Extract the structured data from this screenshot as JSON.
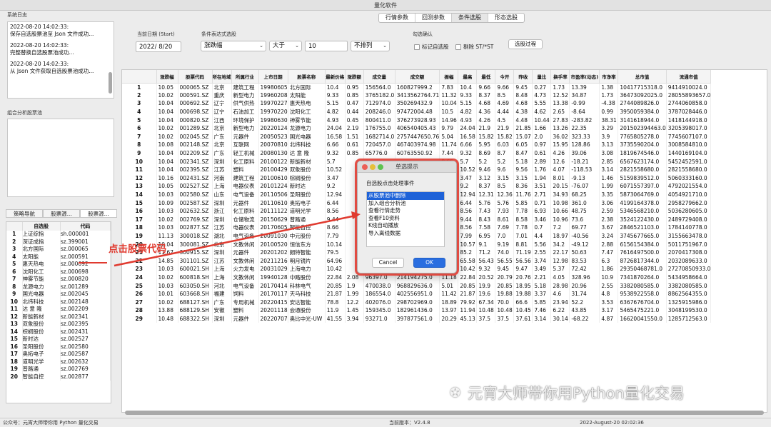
{
  "window": {
    "title": "量化软件"
  },
  "top_tabs": [
    "行情参数",
    "回测参数",
    "条件选股",
    "形态选股"
  ],
  "left": {
    "log_label": "系统日志",
    "log_lines": [
      "2022-08-20 14:02:33:",
      "保存自选股票池至 Json 文件成功...",
      "2022-08-20 14:02:33:",
      "完整替换自选股票池成功...",
      "2022-08-20 14:02:33:",
      "从 Json 文件获取自选股票池成功..."
    ],
    "combo_label": "组合分析股票池",
    "tabs": [
      "策略导航",
      "股票源...",
      "股票源..."
    ],
    "table_headers": [
      "",
      "自选股",
      "代码"
    ],
    "rows": [
      [
        "1",
        "上证综指",
        "sh.000001"
      ],
      [
        "2",
        "深证成指",
        "sz.399001"
      ],
      [
        "3",
        "北方国际",
        "sz.000065"
      ],
      [
        "4",
        "太阳能",
        "sz.000591"
      ],
      [
        "5",
        "惠天热电",
        "sz.000692"
      ],
      [
        "6",
        "沈阳化工",
        "sz.000698"
      ],
      [
        "7",
        "神雾节能",
        "sz.000820"
      ],
      [
        "8",
        "龙源电力",
        "sz.001289"
      ],
      [
        "9",
        "国光电器",
        "sz.002045"
      ],
      [
        "10",
        "北纬科技",
        "sz.002148"
      ],
      [
        "11",
        "达 意 隆",
        "sz.002209"
      ],
      [
        "12",
        "新能新材",
        "sz.002341"
      ],
      [
        "13",
        "双象股份",
        "sz.002395"
      ],
      [
        "14",
        "棕榈股份",
        "sz.002431"
      ],
      [
        "15",
        "新时达",
        "sz.002527"
      ],
      [
        "16",
        "圣阳股份",
        "sz.002580"
      ],
      [
        "17",
        "奥拓电子",
        "sz.002587"
      ],
      [
        "18",
        "道明光学",
        "sz.002632"
      ],
      [
        "19",
        "普路通",
        "sz.002769"
      ],
      [
        "20",
        "智能自控",
        "sz.002877"
      ]
    ]
  },
  "controls": {
    "date_label": "当前日期 (Start)",
    "date_value": "2022/  8/20",
    "cond_label": "条件表达式选股",
    "field_value": "涨跌幅",
    "op_value": "大于",
    "num_value": "10",
    "sort_value": "不排列",
    "confirm_label": "勾选确认",
    "chk1": "标记自选股",
    "chk2": "剔除 ST/*ST",
    "run_button": "选股过程"
  },
  "main_table": {
    "headers": [
      "",
      "涨跌幅",
      "股票代码",
      "所在地域",
      "所属行业",
      "上市日期",
      "股票名称",
      "最新价格",
      "涨跌额",
      "成交量",
      "成交额",
      "振幅",
      "最高",
      "最低",
      "今开",
      "昨收",
      "量比",
      "换手率",
      "市盈率(动态)",
      "市净率",
      "总市值",
      "流通市值"
    ],
    "rows": [
      [
        "1",
        "10.05",
        "000065.SZ",
        "北京",
        "建筑工程",
        "19980605",
        "北方国际",
        "10.4",
        "0.95",
        "156564.0",
        "160827999.2",
        "7.83",
        "10.4",
        "9.66",
        "9.66",
        "9.45",
        "0.27",
        "1.73",
        "13.39",
        "1.38",
        "10417715318.0",
        "9414910024.0"
      ],
      [
        "2",
        "10.02",
        "000591.SZ",
        "重庆",
        "新型电力",
        "19960208",
        "太阳能",
        "9.33",
        "0.85",
        "3765182.0",
        "3413562764.71",
        "11.32",
        "9.33",
        "8.37",
        "8.5",
        "8.48",
        "4.73",
        "12.52",
        "34.87",
        "1.73",
        "36473092025.0",
        "28055893657.0"
      ],
      [
        "3",
        "10.04",
        "000692.SZ",
        "辽宁",
        "供气供热",
        "19970227",
        "惠天热电",
        "5.15",
        "0.47",
        "712974.0",
        "350269432.9",
        "10.04",
        "5.15",
        "4.68",
        "4.69",
        "4.68",
        "5.55",
        "13.38",
        "-0.99",
        "-4.38",
        "2744089826.0",
        "2744060858.0"
      ],
      [
        "4",
        "10.04",
        "000698.SZ",
        "辽宁",
        "石油加工",
        "19970220",
        "沈阳化工",
        "4.82",
        "0.44",
        "208246.0",
        "97472004.48",
        "10.5",
        "4.82",
        "4.36",
        "4.44",
        "4.38",
        "4.62",
        "2.65",
        "-8.64",
        "0.99",
        "3950059384.0",
        "3787028446.0"
      ],
      [
        "5",
        "10.04",
        "000820.SZ",
        "江西",
        "环境保护",
        "19980630",
        "神雾节能",
        "4.93",
        "0.45",
        "800411.0",
        "376273928.93",
        "14.96",
        "4.93",
        "4.26",
        "4.5",
        "4.48",
        "10.44",
        "27.83",
        "-283.82",
        "38.31",
        "3141618944.0",
        "1418144918.0"
      ],
      [
        "6",
        "10.02",
        "001289.SZ",
        "北京",
        "新型电力",
        "20220124",
        "龙源电力",
        "24.04",
        "2.19",
        "176755.0",
        "406540405.43",
        "9.79",
        "24.04",
        "21.9",
        "21.9",
        "21.85",
        "1.66",
        "13.26",
        "22.35",
        "3.29",
        "201502394463.0",
        "3205398017.0"
      ],
      [
        "7",
        "10.02",
        "002045.SZ",
        "广东",
        "元器件",
        "20050523",
        "国光电器",
        "16.58",
        "1.51",
        "1682714.0",
        "2757447650.76",
        "5.04",
        "16.58",
        "15.82",
        "15.82",
        "15.07",
        "2.0",
        "36.02",
        "323.33",
        "3.9",
        "7765805278.0",
        "7745607107.0"
      ],
      [
        "8",
        "10.08",
        "002148.SZ",
        "北京",
        "互联网",
        "20070810",
        "北纬科技",
        "6.66",
        "0.61",
        "720457.0",
        "467403974.98",
        "11.74",
        "6.66",
        "5.95",
        "6.03",
        "6.05",
        "0.97",
        "15.95",
        "128.86",
        "3.13",
        "3735590204.0",
        "3008584810.0"
      ],
      [
        "9",
        "10.04",
        "002209.SZ",
        "广东",
        "轻工机械",
        "20080130",
        "达 意 隆",
        "9.32",
        "0.85",
        "65776.0",
        "60763550.92",
        "7.44",
        "9.32",
        "8.69",
        "8.7",
        "8.47",
        "0.61",
        "4.26",
        "39.06",
        "3.08",
        "1819674546.0",
        "1440169104.0"
      ],
      [
        "10",
        "10.04",
        "002341.SZ",
        "深圳",
        "化工原料",
        "20100122",
        "新能新材",
        "5.7",
        "",
        "",
        "",
        "9.65",
        "5.7",
        "5.2",
        "5.2",
        "5.18",
        "2.89",
        "12.6",
        "-18.21",
        "2.85",
        "6567623174.0",
        "5452452591.0"
      ],
      [
        "11",
        "10.04",
        "002395.SZ",
        "江苏",
        "塑料",
        "20100429",
        "双象股份",
        "10.52",
        "",
        "",
        "",
        "11.09",
        "10.52",
        "9.46",
        "9.6",
        "9.56",
        "1.76",
        "4.07",
        "-118.53",
        "3.14",
        "2821558680.0",
        "2821558680.0"
      ],
      [
        "12",
        "10.16",
        "002431.SZ",
        "河南",
        "建筑工程",
        "20100610",
        "棕榈股份",
        "3.47",
        "",
        "",
        "",
        "11.11",
        "3.47",
        "3.12",
        "3.15",
        "3.15",
        "1.94",
        "8.01",
        "-9.13",
        "1.46",
        "5159839512.0",
        "5060333160.0"
      ],
      [
        "13",
        "10.05",
        "002527.SZ",
        "上海",
        "电器仪表",
        "20101224",
        "新时达",
        "9.2",
        "",
        "",
        "",
        "9.93",
        "9.2",
        "8.37",
        "8.5",
        "8.36",
        "3.51",
        "20.15",
        "-76.07",
        "1.99",
        "6071557397.0",
        "4792021554.0"
      ],
      [
        "14",
        "10.03",
        "002580.SZ",
        "山东",
        "电气设备",
        "20110506",
        "圣阳股份",
        "12.94",
        "",
        "",
        "",
        "5.36",
        "12.94",
        "12.31",
        "12.36",
        "11.76",
        "2.71",
        "34.93",
        "68.25",
        "3.35",
        "5873064769.0",
        "4054921710.0"
      ],
      [
        "15",
        "10.09",
        "002587.SZ",
        "深圳",
        "元器件",
        "20110610",
        "奥拓电子",
        "6.44",
        "",
        "",
        "",
        "11.62",
        "6.44",
        "5.76",
        "5.76",
        "5.85",
        "0.71",
        "10.98",
        "361.0",
        "3.06",
        "4199164378.0",
        "2958279662.0"
      ],
      [
        "16",
        "10.03",
        "002632.SZ",
        "浙江",
        "化工原料",
        "20111122",
        "道明光学",
        "8.56",
        "",
        "",
        "",
        "14.52",
        "8.56",
        "7.43",
        "7.93",
        "7.78",
        "6.93",
        "10.66",
        "48.75",
        "2.59",
        "5346568210.0",
        "5036280605.0"
      ],
      [
        "17",
        "10.02",
        "002769.SZ",
        "深圳",
        "仓储物流",
        "20150629",
        "普路通",
        "9.44",
        "",
        "",
        "",
        "11.77",
        "9.44",
        "8.43",
        "8.61",
        "8.58",
        "3.46",
        "10.96",
        "73.6",
        "2.38",
        "3524122430.0",
        "2489729408.0"
      ],
      [
        "18",
        "10.03",
        "002877.SZ",
        "江苏",
        "电器仪表",
        "20170605",
        "智能自控",
        "8.66",
        "",
        "",
        "",
        "12.6",
        "8.56",
        "7.58",
        "7.69",
        "7.78",
        "0.7",
        "7.2",
        "69.77",
        "3.67",
        "2846521103.0",
        "1784140778.0"
      ],
      [
        "19",
        "11.13",
        "300018.SZ",
        "湖北",
        "电气设备",
        "20091030",
        "中元股份",
        "7.79",
        "",
        "",
        "",
        "14.84",
        "7.99",
        "6.95",
        "7.0",
        "7.01",
        "4.4",
        "18.97",
        "-40.56",
        "3.24",
        "3745677665.0",
        "3155663478.0"
      ],
      [
        "20",
        "10.04",
        "300081.SZ",
        "北京",
        "文教休闲",
        "20100520",
        "恒信东方",
        "10.14",
        "",
        "",
        "",
        "16.69",
        "10.57",
        "9.1",
        "9.19",
        "8.81",
        "5.56",
        "34.2",
        "-49.12",
        "2.88",
        "6156154384.0",
        "5011751967.0"
      ],
      [
        "21",
        "11.67",
        "300915.SZ",
        "深圳",
        "元器件",
        "20201202",
        "朗特智能",
        "79.5",
        "",
        "",
        "",
        "19.67",
        "85.2",
        "71.2",
        "74.0",
        "71.19",
        "2.55",
        "22.17",
        "50.63",
        "7.47",
        "7616497500.0",
        "2070417308.0"
      ],
      [
        "22",
        "14.85",
        "301101.SZ",
        "江苏",
        "文教休闲",
        "20211216",
        "明月镜片",
        "64.96",
        "",
        "",
        "",
        "16.18",
        "65.58",
        "56.43",
        "56.55",
        "56.56",
        "3.74",
        "12.98",
        "83.53",
        "6.3",
        "8726817344.0",
        "2032089633.0"
      ],
      [
        "23",
        "10.03",
        "600021.SH",
        "上海",
        "火力发电",
        "20031029",
        "上海电力",
        "10.42",
        "",
        "",
        "",
        "11.62",
        "10.42",
        "9.32",
        "9.45",
        "9.47",
        "3.49",
        "5.37",
        "72.42",
        "1.86",
        "29350468781.0",
        "27270850933.0"
      ],
      [
        "24",
        "10.02",
        "600818.SH",
        "上海",
        "文教休闲",
        "19940128",
        "中路股份",
        "22.84",
        "2.08",
        "96397.0",
        "214194275.0",
        "11.18",
        "22.84",
        "20.52",
        "20.79",
        "20.76",
        "2.21",
        "4.05",
        "328.96",
        "10.9",
        "7341870264.0",
        "5434958664.0"
      ],
      [
        "25",
        "10.03",
        "603050.SH",
        "河北",
        "电气设备",
        "20170414",
        "科林电气",
        "20.85",
        "1.9",
        "470038.0",
        "968829636.0",
        "5.01",
        "20.85",
        "19.9",
        "20.85",
        "18.95",
        "5.18",
        "28.98",
        "20.96",
        "2.55",
        "3382080585.0",
        "3382080585.0"
      ],
      [
        "26",
        "10.01",
        "603668.SH",
        "福建",
        "饲料",
        "20170117",
        "天马科技",
        "21.87",
        "1.99",
        "186554.0",
        "402556951.0",
        "11.42",
        "21.87",
        "19.6",
        "19.88",
        "19.88",
        "3.37",
        "4.6",
        "31.74",
        "4.8",
        "9538922558.0",
        "8862564355.0"
      ],
      [
        "27",
        "10.02",
        "688127.SH",
        "广东",
        "专用机械",
        "20220415",
        "安达智能",
        "78.8",
        "12.2",
        "402076.0",
        "298702969.0",
        "18.89",
        "79.92",
        "67.34",
        "70.0",
        "66.6",
        "5.85",
        "23.94",
        "52.2",
        "3.53",
        "6367676704.0",
        "1325915986.0"
      ],
      [
        "28",
        "13.88",
        "688129.SH",
        "安徽",
        "塑料",
        "20201118",
        "会通股份",
        "11.9",
        "1.45",
        "159345.0",
        "182961436.0",
        "13.97",
        "11.94",
        "10.48",
        "10.48",
        "10.45",
        "7.46",
        "6.22",
        "43.85",
        "3.17",
        "5465475221.0",
        "3048199530.0"
      ],
      [
        "29",
        "10.48",
        "688322.SH",
        "深圳",
        "元器件",
        "20220707",
        "奥比中光-UW",
        "41.55",
        "3.94",
        "93271.0",
        "397877561.0",
        "20.29",
        "45.13",
        "37.5",
        "37.5",
        "37.61",
        "3.14",
        "30.14",
        "-68.22",
        "4.87",
        "16620041550.0",
        "1285712563.0"
      ]
    ]
  },
  "dialog": {
    "title": "单选提示",
    "heading": "自选股点击处理事件",
    "options": [
      "从股票池中删除",
      "加入组合分析池",
      "查看行情走势",
      "查看F10资料",
      "K线自动播放",
      "导入离线数据"
    ],
    "cancel": "Cancel",
    "ok": "OK"
  },
  "annotation": "点击股票代码",
  "watermark": "元宵大师带你用Python量化交易",
  "status": {
    "left": "公众号：元宵大师带你用 Python 量化交易",
    "version": "当前版本：V2.4.8",
    "time": "2022-August-20 02:02:36"
  }
}
